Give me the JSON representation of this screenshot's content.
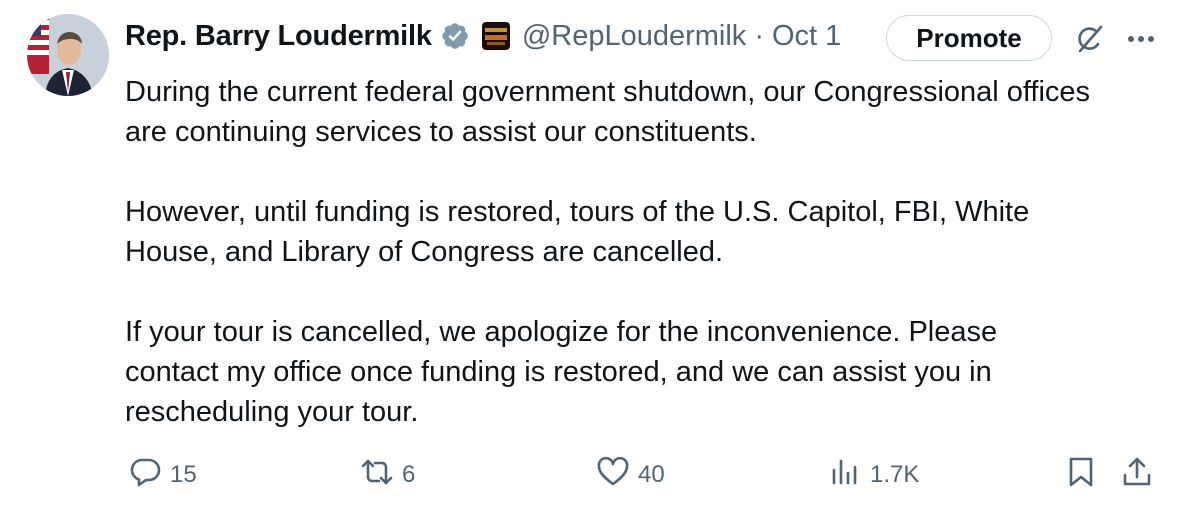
{
  "tweet": {
    "author_name": "Rep. Barry Loudermilk",
    "handle": "@RepLoudermilk",
    "separator": "·",
    "date": "Oct 1",
    "promote_label": "Promote",
    "paragraphs": [
      [
        "During the current federal government shutdown, our Congressional offices",
        "are continuing services to assist our constituents."
      ],
      [
        "However, until funding is restored, tours of the U.S. Capitol, FBI, White",
        "House, and Library of Congress are cancelled."
      ],
      [
        "If your tour is cancelled, we apologize for the inconvenience. Please",
        "contact my office once funding is restored, and we can assist you in",
        "rescheduling your tour."
      ]
    ]
  },
  "actions": {
    "replies": "15",
    "reposts": "6",
    "likes": "40",
    "views": "1.7K"
  },
  "icons": [
    "verified-badge-icon",
    "affiliation-badge-icon",
    "grok-icon",
    "more-icon",
    "reply-icon",
    "repost-icon",
    "like-icon",
    "views-icon",
    "bookmark-icon",
    "share-icon"
  ],
  "colors": {
    "text": "#0f1419",
    "secondary": "#536471",
    "border": "#cfd9de",
    "verified": "#829aab"
  }
}
